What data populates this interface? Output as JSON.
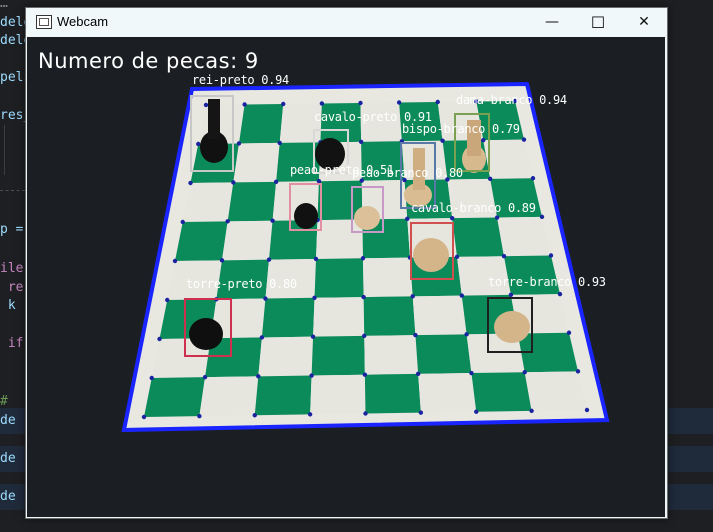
{
  "window": {
    "title": "Webcam",
    "minimize_glyph": "—",
    "maximize_glyph": "☐",
    "close_glyph": "✕"
  },
  "overlay": {
    "count_text": "Numero de pecas: 9"
  },
  "detections": [
    {
      "label": "rei-preto 0.94",
      "color": "#c8c8c8"
    },
    {
      "label": "cavalo-preto 0.91",
      "color": "#d8d8d8"
    },
    {
      "label": "dama-branco 0.94",
      "color": "#7aa050"
    },
    {
      "label": "bispo-branco 0.79",
      "color": "#5878a8"
    },
    {
      "label": "peao-preto 0.51",
      "color": "#e090a0"
    },
    {
      "label": "peao-branco 0.80",
      "color": "#c898c8"
    },
    {
      "label": "cavalo-branco 0.89",
      "color": "#d05050"
    },
    {
      "label": "torre-preto 0.80",
      "color": "#d03050"
    },
    {
      "label": "torre-branco 0.93",
      "color": "#202020"
    }
  ],
  "editor_fragments": {
    "l1": "delo",
    "l2": "delo",
    "l3": "pels",
    "l4": "res_",
    "l5": "p =",
    "l6": "ile",
    "l7": " re",
    "l8": " k",
    "l9": " if",
    "l10": "#",
    "l11": "de",
    "l12": "de",
    "l13": "de",
    "tab": "…"
  }
}
